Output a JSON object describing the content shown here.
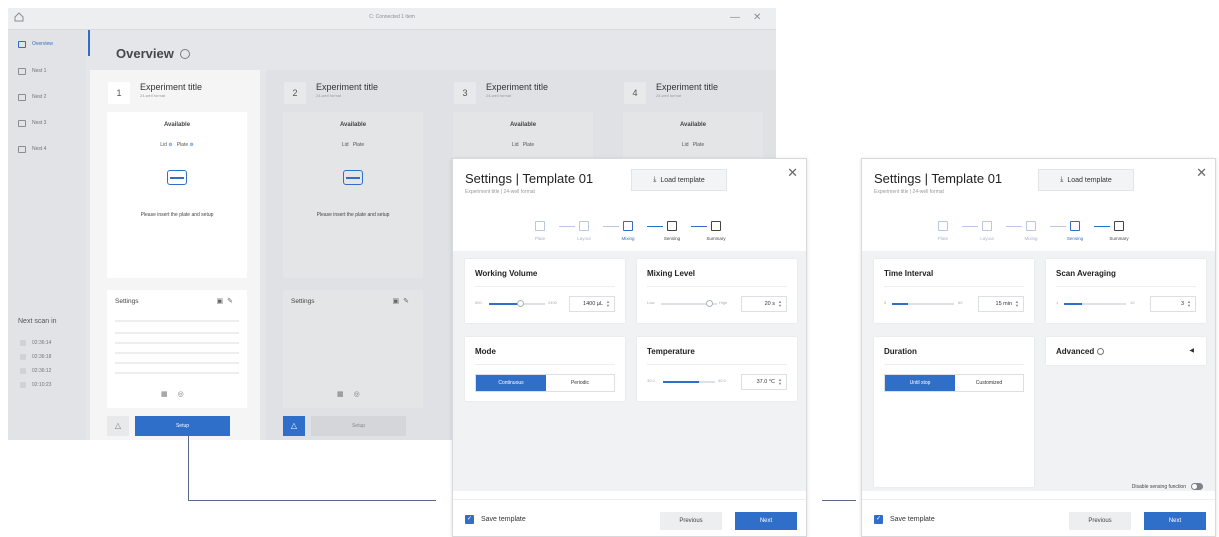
{
  "app": {
    "window_title": "C: Connected 1 item",
    "nav": [
      "Overview",
      "Nest 1",
      "Nest 2",
      "Nest 3",
      "Nest 4"
    ],
    "overview_title": "Overview",
    "next_scan_title": "Next scan in",
    "next_scans": [
      "02:36:14",
      "02:36:18",
      "02:36:12",
      "02:10:23"
    ],
    "experiments": [
      {
        "num": "1",
        "title": "Experiment title",
        "sub": "24-well format",
        "available": "Available",
        "lid": "Lid",
        "plate": "Plate",
        "message": "Please insert the plate and setup",
        "settings": "Settings",
        "setup": "Setup"
      },
      {
        "num": "2",
        "title": "Experiment title",
        "sub": "24-well format",
        "available": "Available",
        "lid": "Lid",
        "plate": "Plate",
        "message": "Please insert the plate and setup",
        "settings": "Settings",
        "setup": "Setup"
      },
      {
        "num": "3",
        "title": "Experiment title",
        "sub": "24-well format",
        "available": "Available",
        "lid": "Lid",
        "plate": "Plate"
      },
      {
        "num": "4",
        "title": "Experiment title",
        "sub": "24-well format",
        "available": "Available",
        "lid": "Lid",
        "plate": "Plate"
      }
    ]
  },
  "dialog1": {
    "title": "Settings | Template 01",
    "subtitle": "Experiment title  |  24-well format",
    "load_template": "Load template",
    "steps": [
      "Plate",
      "Layout",
      "Mixing",
      "Sensing",
      "Summary"
    ],
    "working_volume": {
      "title": "Working Volume",
      "min": "500",
      "max": "2400",
      "value": "1400 µL",
      "fraction": 0.55
    },
    "mixing_level": {
      "title": "Mixing Level",
      "min": "Low",
      "max": "High",
      "value": "20 s",
      "fraction": 0.85
    },
    "mode": {
      "title": "Mode",
      "options": [
        "Continuous",
        "Periodic"
      ],
      "selected": "Continuous"
    },
    "temperature": {
      "title": "Temperature",
      "min": "30.0",
      "max": "40.0",
      "value": "37.0 °C",
      "fraction": 0.7
    },
    "save_template": "Save template",
    "previous": "Previous",
    "next": "Next"
  },
  "dialog2": {
    "title": "Settings | Template 01",
    "subtitle": "Experiment title  |  24-well format",
    "load_template": "Load template",
    "steps": [
      "Plate",
      "Layout",
      "Mixing",
      "Sensing",
      "Summary"
    ],
    "time_interval": {
      "title": "Time Interval",
      "min": "5",
      "max": "60",
      "value": "15 min",
      "fraction": 0.2
    },
    "scan_averaging": {
      "title": "Scan Averaging",
      "min": "1",
      "max": "10",
      "value": "3",
      "fraction": 0.25
    },
    "duration": {
      "title": "Duration",
      "options": [
        "Until stop",
        "Customized"
      ],
      "selected": "Until stop"
    },
    "advanced": "Advanced",
    "disable_sensing": "Disable sensing function",
    "save_template": "Save template",
    "previous": "Previous",
    "next": "Next"
  },
  "colors": {
    "accent": "#2f6ec9",
    "panel_bg": "#f1f2f4",
    "app_bg": "#e5e6e9"
  }
}
